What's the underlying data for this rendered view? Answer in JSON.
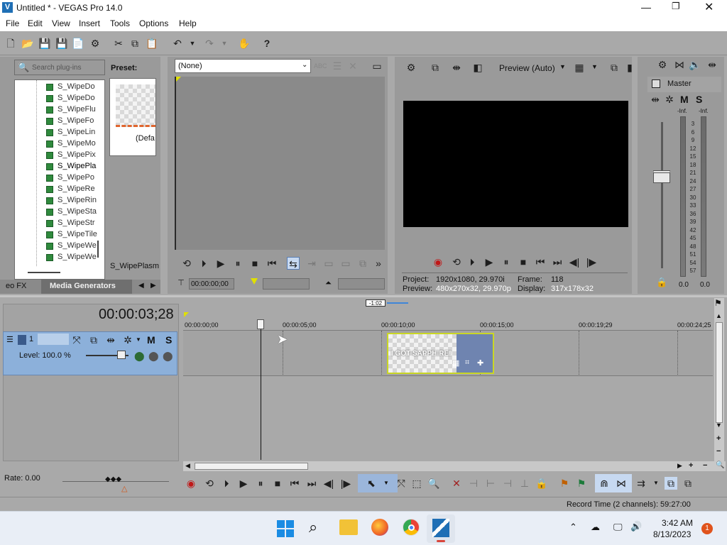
{
  "window": {
    "title": "Untitled * - VEGAS Pro 14.0"
  },
  "menu": [
    "File",
    "Edit",
    "View",
    "Insert",
    "Tools",
    "Options",
    "Help"
  ],
  "plugins": {
    "search_placeholder": "Search plug-ins",
    "items": [
      "S_WipeDo",
      "S_WipeDo",
      "S_WipeFlu",
      "S_WipeFo",
      "S_WipeLin",
      "S_WipeMo",
      "S_WipePix",
      "S_WipePla",
      "S_WipePo",
      "S_WipeRe",
      "S_WipeRin",
      "S_WipeSta",
      "S_WipeStr",
      "S_WipeTile",
      "S_WipeWe",
      "S_WipeWe"
    ],
    "selected_index": 7,
    "preset_label": "Preset:",
    "preset_item": "(Defa",
    "selected_name": "S_WipePlasm",
    "tab_video_fx": "eo FX",
    "tab_media_generators": "Media Generators"
  },
  "trimmer": {
    "dropdown_value": "(None)",
    "timecode": "00:00:00;00"
  },
  "preview": {
    "mode": "Preview (Auto)",
    "project_label": "Project:",
    "project_value": "1920x1080, 29.970i",
    "preview_label": "Preview:",
    "preview_value": "480x270x32, 29.970p",
    "frame_label": "Frame:",
    "frame_value": "118",
    "display_label": "Display:",
    "display_value": "317x178x32"
  },
  "master": {
    "label": "Master",
    "m": "M",
    "s": "S",
    "inf_left": "-Inf.",
    "inf_right": "-Inf.",
    "scale": [
      "3",
      "6",
      "9",
      "12",
      "15",
      "18",
      "21",
      "24",
      "27",
      "30",
      "33",
      "36",
      "39",
      "42",
      "45",
      "48",
      "51",
      "54",
      "57"
    ],
    "val_left": "0.0",
    "val_right": "0.0"
  },
  "timeline": {
    "timecode": "00:00:03;28",
    "loop_marker": "-1:02",
    "ruler": [
      "00:00:00;00",
      "00:00:05;00",
      "00:00:10;00",
      "00:00:15;00",
      "00:00:19;29",
      "00:00:24;25"
    ],
    "track_number": "1",
    "track_m": "M",
    "track_s": "S",
    "level": "Level: 100.0 %",
    "clip_text": "I GOT SAPPHIRE!",
    "rate": "Rate: 0.00",
    "record_time": "Record Time (2 channels): 59:27:00"
  },
  "taskbar": {
    "time": "3:42 AM",
    "date": "8/13/2023",
    "notifications": "1"
  }
}
